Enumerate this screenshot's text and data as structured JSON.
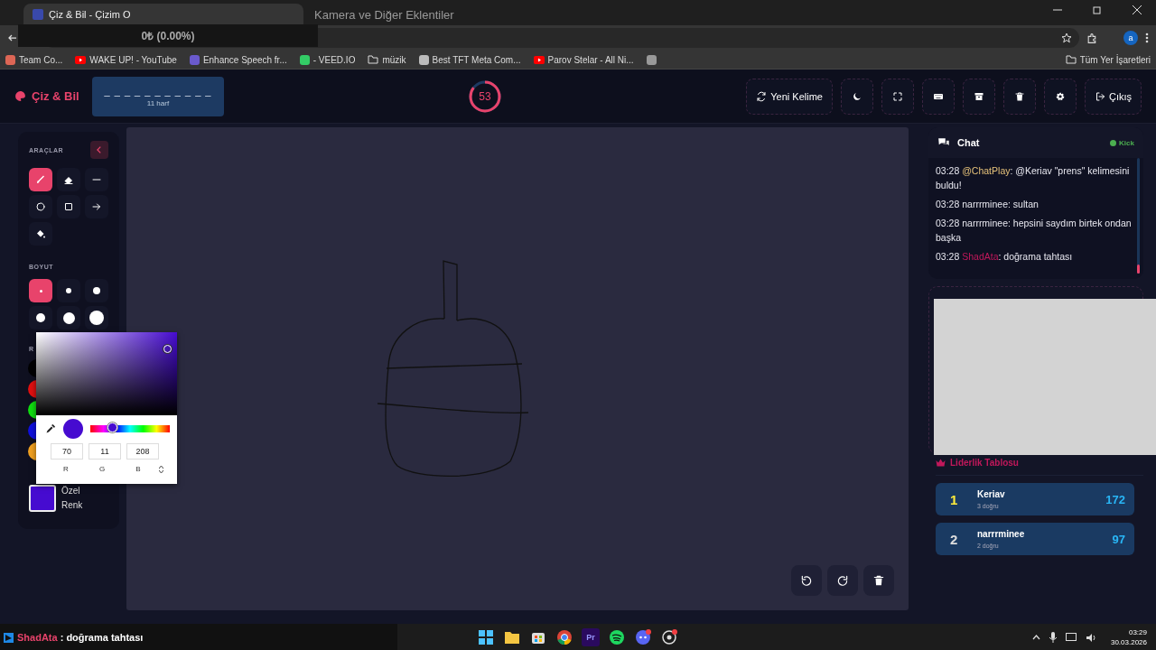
{
  "browser": {
    "tabs": [
      {
        "title": "Çiz & Bil - Çizim O",
        "selected": true
      },
      {
        "title": "Kamera ve Diğer Eklentiler",
        "selected": false
      }
    ],
    "overlay_text": "0₺ (0.00%)",
    "profile": "a",
    "bookmarks": [
      {
        "kind": "team",
        "label": "Team Co..."
      },
      {
        "kind": "youtube",
        "label": "WAKE UP! - YouTube"
      },
      {
        "kind": "app",
        "label": "Enhance Speech fr..."
      },
      {
        "kind": "veed",
        "label": "- VEED.IO"
      },
      {
        "kind": "folder",
        "label": "müzik"
      },
      {
        "kind": "tft",
        "label": "Best TFT Meta Com..."
      },
      {
        "kind": "youtube",
        "label": "Parov Stelar - All Ni..."
      },
      {
        "kind": "misc"
      }
    ],
    "all_bookmarks": "Tüm Yer İşaretleri"
  },
  "header": {
    "logo": "Çiz & Bil",
    "word_hint": "_ _ _ _ _ _ _ _ _ _ _",
    "letter_count": "11 harf",
    "timer": "53",
    "buttons": [
      {
        "kind": "refresh",
        "label": "Yeni Kelime"
      },
      {
        "kind": "moon"
      },
      {
        "kind": "expand"
      },
      {
        "kind": "keyboard"
      },
      {
        "kind": "archive"
      },
      {
        "kind": "trash"
      },
      {
        "kind": "gear"
      },
      {
        "kind": "exit",
        "label": "Çıkış"
      }
    ]
  },
  "tools": {
    "title": "ARAÇLAR",
    "items": [
      {
        "kind": "brush",
        "selected": true
      },
      {
        "kind": "eraser",
        "selected": false
      },
      {
        "kind": "line",
        "selected": false
      },
      {
        "kind": "circle",
        "selected": false
      },
      {
        "kind": "square",
        "selected": false
      },
      {
        "kind": "arrow",
        "selected": false
      },
      {
        "kind": "fill",
        "selected": false
      }
    ],
    "size_title": "BOYUT",
    "sizes": [
      {
        "selected": true
      },
      {
        "selected": false
      },
      {
        "selected": false
      },
      {
        "selected": false
      },
      {
        "selected": false
      },
      {
        "selected": false
      }
    ],
    "color_title": "R",
    "swatches": [
      {
        "color": "#000000"
      },
      {
        "color": "#e01010"
      },
      {
        "color": "#10dd10"
      },
      {
        "color": "#1010dd"
      },
      {
        "color": "#f0a020"
      }
    ],
    "custom": {
      "label": "Özel Renk",
      "color": "#460bd0"
    },
    "picker": {
      "hue": {
        "level": 0.28
      },
      "r": "70",
      "g": "11",
      "b": "208",
      "r_label": "R",
      "g_label": "G",
      "b_label": "B"
    }
  },
  "canvas": {
    "controls": [
      {
        "kind": "undo"
      },
      {
        "kind": "redo"
      },
      {
        "kind": "trash"
      }
    ]
  },
  "chat": {
    "title": "Chat",
    "status": "Kick",
    "messages": [
      {
        "time": "03:28",
        "user": "@ChatPlay",
        "color": "#e6c27a",
        "text": ": @Keriav \"prens\" kelimesini buldu!"
      },
      {
        "time": "03:28",
        "user": "narrrminee",
        "color": "#e8e8f0",
        "text": ": sultan"
      },
      {
        "time": "03:28",
        "user": "narrrminee",
        "color": "#e8e8f0",
        "text": ": hepsini saydım birtek ondan başka"
      },
      {
        "time": "03:28",
        "user": "ShadAta",
        "color": "#c2185b",
        "text": ": doğrama tahtası"
      }
    ]
  },
  "leaderboard": {
    "title": "Liderlik Tablosu",
    "entries": [
      {
        "rank": "1",
        "name": "Keriav",
        "detail": "3 doğru",
        "score": "172"
      },
      {
        "rank": "2",
        "name": "narrrminee",
        "detail": "2 doğru",
        "score": "97"
      }
    ]
  },
  "taskbar": {
    "ticker_user": "ShadAta",
    "ticker_text": ": doğrama tahtası",
    "apps": [
      {
        "kind": "windows"
      },
      {
        "kind": "files"
      },
      {
        "kind": "store"
      },
      {
        "kind": "chrome"
      },
      {
        "kind": "premiere",
        "label": "Pr"
      },
      {
        "kind": "spotify"
      },
      {
        "kind": "discord"
      },
      {
        "kind": "obs"
      }
    ],
    "time": "03:29",
    "date": "30.03.2026"
  }
}
